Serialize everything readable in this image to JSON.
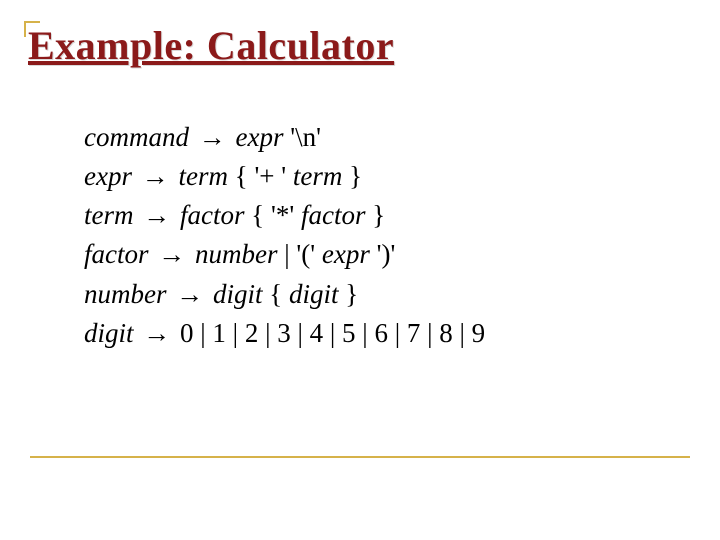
{
  "title": "Example: Calculator",
  "arrow": "→",
  "grammar": {
    "r1": {
      "lhs": "command",
      "rhs_nt": "expr",
      "rhs_lit": " '\\n'"
    },
    "r2": {
      "lhs": "expr",
      "rhs_nt1": "term",
      "mid": " { '+ ' ",
      "rhs_nt2": "term",
      "tail": " }"
    },
    "r3": {
      "lhs": "term",
      "rhs_nt1": "factor",
      "mid": " { '*' ",
      "rhs_nt2": "factor",
      "tail": " }"
    },
    "r4": {
      "lhs": "factor",
      "rhs_nt1": "number",
      "mid": " | '(' ",
      "rhs_nt2": "expr",
      "tail": " ')'"
    },
    "r5": {
      "lhs": "number",
      "rhs_nt1": "digit",
      "mid": " { ",
      "rhs_nt2": "digit",
      "tail": " }"
    },
    "r6": {
      "lhs": "digit",
      "rhs": " 0 | 1 | 2 | 3 | 4 | 5 | 6 | 7 | 8 | 9"
    }
  }
}
